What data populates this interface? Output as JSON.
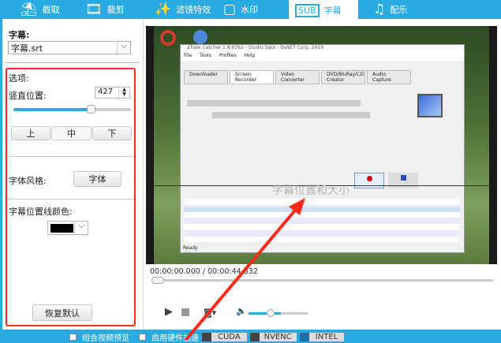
{
  "tabs": [
    {
      "label": "截取",
      "icon": "cake-icon"
    },
    {
      "label": "裁剪",
      "icon": "film-icon"
    },
    {
      "label": "滤镜特效",
      "icon": "magic-wand-icon"
    },
    {
      "label": "水印",
      "icon": "watermark-icon"
    },
    {
      "label": "字幕",
      "icon": "subtitle-icon",
      "active": true
    },
    {
      "label": "配乐",
      "icon": "music-icon"
    }
  ],
  "subtitle": {
    "label": "字幕:",
    "file": "字幕.srt"
  },
  "options": {
    "title": "选项:",
    "vpos_label": "竖直位置:",
    "vpos_value": "427",
    "slider_percent": 66,
    "align": [
      "上",
      "中",
      "下"
    ],
    "font_style_label": "字体风格:",
    "font_button": "字体",
    "line_color_label": "字幕位置线颜色:",
    "line_color": "#000000",
    "reset": "恢复默认"
  },
  "player": {
    "time": "00:00:00.000 / 00:00:44.332",
    "progress_percent": 0,
    "volume_percent": 55
  },
  "preview": {
    "window_title": "aTube Catcher 1.8.9762 - Studio Sato - DsNET Corp. 2019",
    "menu": [
      "File",
      "Tools",
      "Profiles",
      "Help"
    ],
    "tabs": [
      "Downloader",
      "Screen Recorder",
      "Video Converter",
      "DVD/BluRay/CD Creator",
      "Audio Capture"
    ],
    "subtitle_overlay": "字幕位置和大小",
    "status": "Ready"
  },
  "bottom": {
    "preview_check": "组合视频预览",
    "hw_check": "启用硬件加速",
    "hw": [
      "CUDA",
      "NVENC",
      "INTEL"
    ]
  },
  "colors": {
    "accent": "#29abe2",
    "highlight": "#ff2a1a"
  }
}
